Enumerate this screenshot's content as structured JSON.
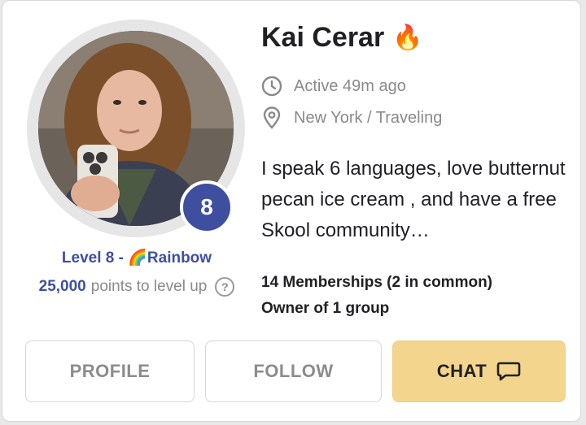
{
  "profile": {
    "name": "Kai Cerar",
    "name_emoji": "🔥",
    "active": "Active 49m ago",
    "location": "New York / Traveling",
    "bio": "I speak 6 languages, love butternut pecan ice cream , and have a free Skool community…",
    "memberships": "14 Memberships (2 in common)",
    "owner": "Owner of 1 group"
  },
  "level": {
    "badge_number": "8",
    "label_prefix": "Level 8 - ",
    "label_emoji": "🌈",
    "label_name": "Rainbow",
    "points_number": "25,000",
    "points_text": "points to level up",
    "help_glyph": "?"
  },
  "buttons": {
    "profile": "PROFILE",
    "follow": "FOLLOW",
    "chat": "CHAT"
  },
  "icons": {
    "active": "clock-icon",
    "location": "location-pin-icon",
    "chat": "chat-bubble-icon",
    "help": "question-circle-icon"
  },
  "colors": {
    "accent_blue": "#3f4fa0",
    "chat_button": "#f4d58d",
    "muted_text": "#8a8a8a"
  }
}
